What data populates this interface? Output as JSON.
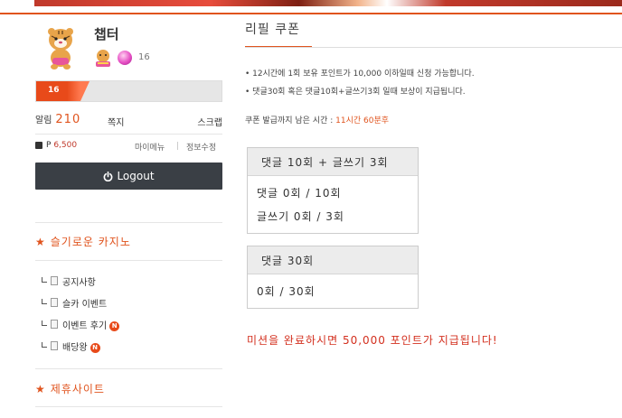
{
  "profile": {
    "nickname": "챕터",
    "level": "16",
    "xp_level": "16",
    "xp_fraction": 0.24
  },
  "stats": {
    "alarm_label": "알림",
    "alarm_count": "210",
    "message_label": "쪽지",
    "scrap_label": "스크랩"
  },
  "points": {
    "prefix": "P",
    "value": "6,500",
    "my_menu": "마이메뉴",
    "edit_info": "정보수정"
  },
  "logout_label": "Logout",
  "sections": {
    "casino_title": "슬기로운 카지노",
    "partner_title": "제휴사이트",
    "star": "★"
  },
  "menu_items": [
    {
      "label": "공지사항",
      "badge": ""
    },
    {
      "label": "슬카 이벤트",
      "badge": ""
    },
    {
      "label": "이벤트 후기",
      "badge": "N"
    },
    {
      "label": "배당왕",
      "badge": "N"
    }
  ],
  "main": {
    "title": "리필 쿠폰",
    "note1": "• 12시간에 1회 보유 포인트가 10,000 이하일때 신청 가능합니다.",
    "note2": "• 댓글30회 혹은 댓글10회+글쓰기3회 일때 보상이 지급됩니다.",
    "remain_label": "쿠폰 발급까지 남은 시간 : ",
    "remain_value": "11시간 60분후",
    "box1": {
      "header": "댓글 10회 + 글쓰기 3회",
      "row1": "댓글 0회 / 10회",
      "row2": "글쓰기 0회 / 3회"
    },
    "box2": {
      "header": "댓글 30회",
      "row1": "0회 / 30회"
    },
    "mission_text": "미션을 완료하시면 50,000 포인트가 지급됩니다!"
  },
  "colors": {
    "accent": "#e0541e",
    "logout_bg": "#3a3f45",
    "mission": "#d32f1e"
  }
}
